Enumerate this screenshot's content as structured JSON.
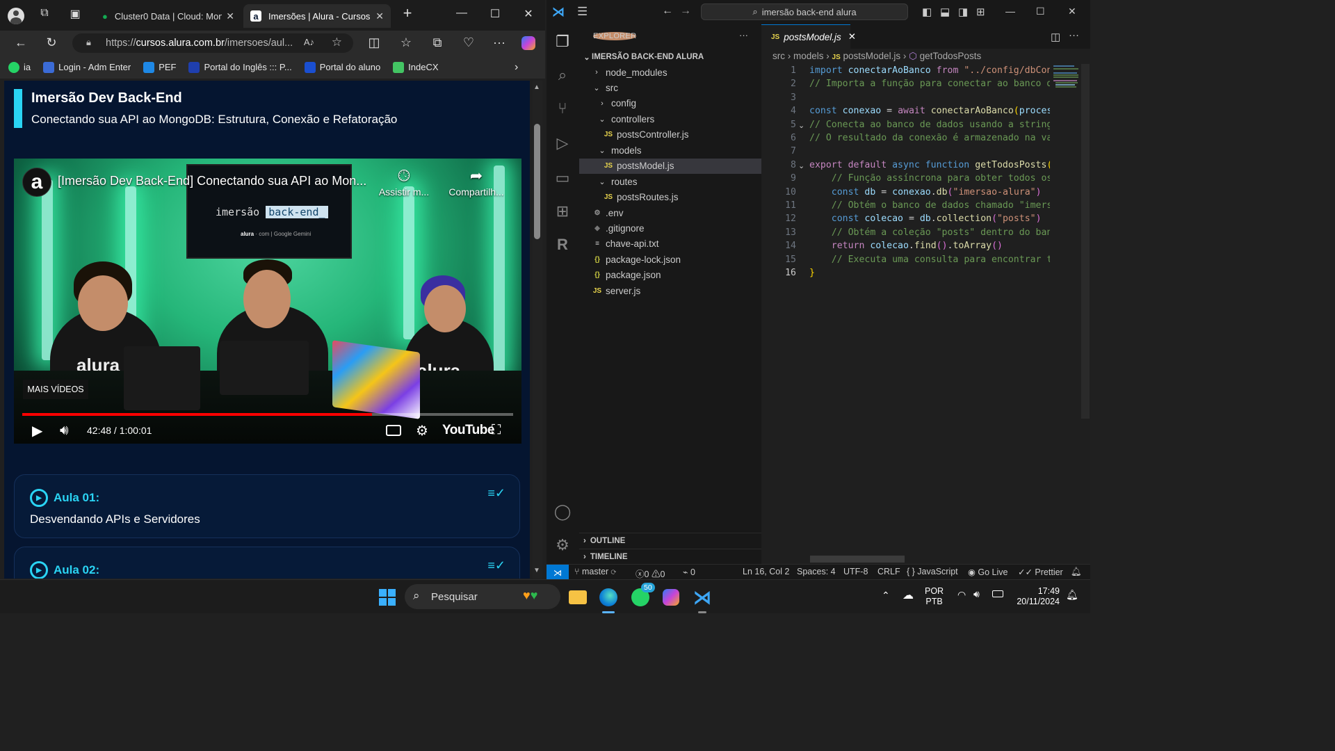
{
  "browser": {
    "tabs": [
      {
        "title": "Cluster0 Data | Cloud: Mong"
      },
      {
        "title": "Imersões | Alura - Cursos on"
      }
    ],
    "url_prefix": "https://",
    "url_domain": "cursos.alura.com.br",
    "url_path": "/imersoes/aul...",
    "favorites": [
      {
        "label": "ia",
        "color": "#25d366"
      },
      {
        "label": "Login - Adm Enter",
        "color": "#3b6bd6"
      },
      {
        "label": "PEF",
        "color": "#1e88e5"
      },
      {
        "label": "Portal do Inglês ::: P...",
        "color": "#1f3fae"
      },
      {
        "label": "Portal do aluno",
        "color": "#1a4fd1"
      },
      {
        "label": "IndeCX",
        "color": "#43c463"
      }
    ]
  },
  "page": {
    "title": "Imersão Dev Back-End",
    "subtitle": "Conectando sua API ao MongoDB: Estrutura, Conexão e Refatoração",
    "video": {
      "title": "[Imersão Dev Back-End] Conectando sua API ao Mon...",
      "watch_later": "Assistir m...",
      "share": "Compartilh...",
      "more_videos": "MAIS VÍDEOS",
      "time": "42:48 / 1:00:01",
      "progress": 0.713,
      "brand": "YouTube",
      "tv_text_1": "imersão",
      "tv_text_2": "back-end_",
      "tv_small": "alura",
      "tv_small_2": "com | Google Gemini",
      "shirt_text": "alura"
    },
    "lessons": [
      {
        "label": "Aula 01:",
        "desc": "Desvendando APIs e Servidores"
      },
      {
        "label": "Aula 02:",
        "desc": ""
      }
    ]
  },
  "vscode": {
    "search": "imersão back-end alura",
    "explorer_label": "EXPLORER",
    "project": "IMERSÃO BACK-END ALURA",
    "tree": [
      {
        "name": "node_modules",
        "type": "folder-closed",
        "depth": 1
      },
      {
        "name": "src",
        "type": "folder-open",
        "depth": 1
      },
      {
        "name": "config",
        "type": "folder-closed",
        "depth": 2
      },
      {
        "name": "controllers",
        "type": "folder-open",
        "depth": 2
      },
      {
        "name": "postsController.js",
        "type": "js",
        "depth": 3
      },
      {
        "name": "models",
        "type": "folder-open",
        "depth": 2
      },
      {
        "name": "postsModel.js",
        "type": "js",
        "depth": 3,
        "selected": true
      },
      {
        "name": "routes",
        "type": "folder-open",
        "depth": 2
      },
      {
        "name": "postsRoutes.js",
        "type": "js",
        "depth": 3
      },
      {
        "name": ".env",
        "type": "gear",
        "depth": 1
      },
      {
        "name": ".gitignore",
        "type": "git",
        "depth": 1
      },
      {
        "name": "chave-api.txt",
        "type": "txt",
        "depth": 1
      },
      {
        "name": "package-lock.json",
        "type": "json",
        "depth": 1
      },
      {
        "name": "package.json",
        "type": "json",
        "depth": 1
      },
      {
        "name": "server.js",
        "type": "js",
        "depth": 1
      }
    ],
    "outline": "OUTLINE",
    "timeline": "TIMELINE",
    "tab_name": "postsModel.js",
    "breadcrumb": [
      "src",
      "models",
      "postsModel.js",
      "getTodosPosts"
    ],
    "code": [
      [
        [
          "k",
          "import "
        ],
        [
          "v",
          "conectarAoBanco "
        ],
        [
          "kc",
          "from "
        ],
        [
          "s",
          "\"../config/dbCon"
        ]
      ],
      [
        [
          "c",
          "// Importa a função para conectar ao banco d"
        ]
      ],
      [],
      [
        [
          "k",
          "const "
        ],
        [
          "v",
          "conexao "
        ],
        [
          "p",
          "= "
        ],
        [
          "kc",
          "await "
        ],
        [
          "f",
          "conectarAoBanco"
        ],
        [
          "br",
          "("
        ],
        [
          "v",
          "proces"
        ]
      ],
      [
        [
          "c",
          "// Conecta ao banco de dados usando a string"
        ]
      ],
      [
        [
          "c",
          "// O resultado da conexão é armazenado na va"
        ]
      ],
      [],
      [
        [
          "kc",
          "export default "
        ],
        [
          "k",
          "async function "
        ],
        [
          "f",
          "getTodosPosts"
        ],
        [
          "br",
          "("
        ]
      ],
      [
        [
          "p",
          "    "
        ],
        [
          "c",
          "// Função assíncrona para obter todos os"
        ]
      ],
      [
        [
          "p",
          "    "
        ],
        [
          "k",
          "const "
        ],
        [
          "v",
          "db "
        ],
        [
          "p",
          "= "
        ],
        [
          "v",
          "conexao"
        ],
        [
          "p",
          "."
        ],
        [
          "f",
          "db"
        ],
        [
          "br2",
          "("
        ],
        [
          "s",
          "\"imersao-alura\""
        ],
        [
          "br2",
          ")"
        ]
      ],
      [
        [
          "p",
          "    "
        ],
        [
          "c",
          "// Obtém o banco de dados chamado \"imers"
        ]
      ],
      [
        [
          "p",
          "    "
        ],
        [
          "k",
          "const "
        ],
        [
          "v",
          "colecao "
        ],
        [
          "p",
          "= "
        ],
        [
          "v",
          "db"
        ],
        [
          "p",
          "."
        ],
        [
          "f",
          "collection"
        ],
        [
          "br2",
          "("
        ],
        [
          "s",
          "\"posts\""
        ],
        [
          "br2",
          ")"
        ]
      ],
      [
        [
          "p",
          "    "
        ],
        [
          "c",
          "// Obtém a coleção \"posts\" dentro do ban"
        ]
      ],
      [
        [
          "p",
          "    "
        ],
        [
          "kc",
          "return "
        ],
        [
          "v",
          "colecao"
        ],
        [
          "p",
          "."
        ],
        [
          "f",
          "find"
        ],
        [
          "br2",
          "()"
        ],
        [
          "p",
          "."
        ],
        [
          "f",
          "toArray"
        ],
        [
          "br2",
          "()"
        ]
      ],
      [
        [
          "p",
          "    "
        ],
        [
          "c",
          "// Executa uma consulta para encontrar t"
        ]
      ],
      [
        [
          "br",
          "}"
        ]
      ]
    ],
    "current_line": 16,
    "status": {
      "branch": "master",
      "errors": "0",
      "warnings": "0",
      "ports": "0",
      "position": "Ln 16, Col 2",
      "spaces": "Spaces: 4",
      "encoding": "UTF-8",
      "eol": "CRLF",
      "language": "JavaScript",
      "golive": "Go Live",
      "prettier": "Prettier"
    }
  },
  "taskbar": {
    "search": "Pesquisar",
    "whatsapp_badge": "50",
    "lang1": "POR",
    "lang2": "PTB",
    "time": "17:49",
    "date": "20/11/2024"
  }
}
